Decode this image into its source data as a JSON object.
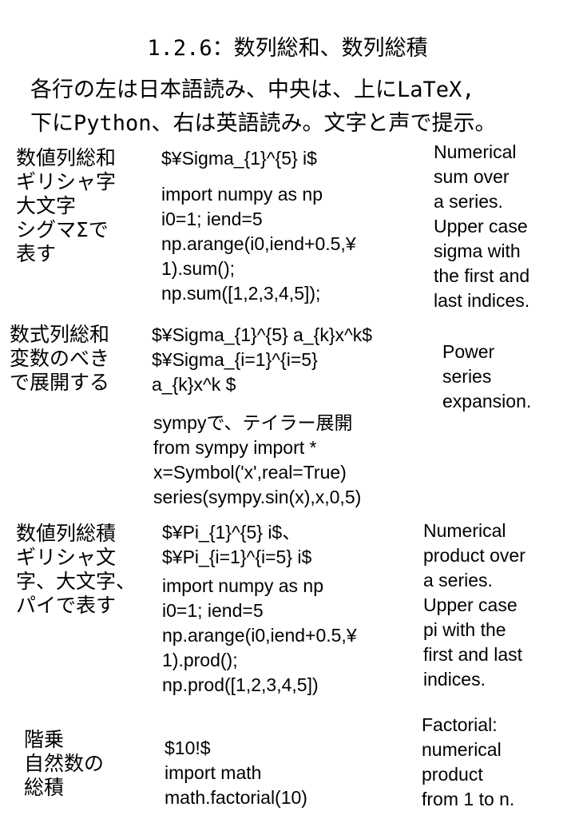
{
  "title": "1.2.6：数列総和、数列総積",
  "intro": [
    "各行の左は日本語読み、中央は、上にLaTeX,",
    "下にPython、右は英語読み。文字と声で提示。"
  ],
  "rows": [
    {
      "jp": [
        "数値列総和",
        "ギリシャ字",
        "大文字",
        "シグマΣで",
        "表す"
      ],
      "latex": [
        "$¥Sigma_{1}^{5} i$"
      ],
      "code": [
        "import numpy as np",
        "i0=1; iend=5",
        "np.arange(i0,iend+0.5,¥",
        "1).sum();",
        "np.sum([1,2,3,4,5]);"
      ],
      "en": [
        "Numerical",
        "sum over",
        "a series.",
        "Upper case",
        "sigma with",
        "the first and",
        "last indices."
      ]
    },
    {
      "jp": [
        "数式列総和",
        "変数のべき",
        "で展開する"
      ],
      "latex": [
        "$¥Sigma_{1}^{5} a_{k}x^k$",
        "$¥Sigma_{i=1}^{i=5}",
        "a_{k}x^k $"
      ],
      "code": [
        "sympyで、テイラー展開",
        "from sympy import *",
        "x=Symbol('x',real=True)",
        "series(sympy.sin(x),x,0,5)"
      ],
      "en": [
        "Power",
        "series",
        "expansion."
      ]
    },
    {
      "jp": [
        "数値列総積",
        "ギリシャ文",
        "字、大文字、",
        "パイで表す"
      ],
      "latex": [
        "$¥Pi_{1}^{5} i$、",
        "$¥Pi_{i=1}^{i=5} i$"
      ],
      "code": [
        "import numpy as np",
        "i0=1; iend=5",
        "np.arange(i0,iend+0.5,¥",
        "1).prod();",
        "np.prod([1,2,3,4,5])"
      ],
      "en": [
        "Numerical",
        "product over",
        "a series.",
        "Upper case",
        "pi with the",
        "first and last",
        "indices."
      ]
    },
    {
      "jp": [
        "階乗",
        "自然数の",
        "総積"
      ],
      "latex": [
        "$10!$"
      ],
      "code": [
        "import math",
        "math.factorial(10)"
      ],
      "en": [
        "Factorial:",
        "numerical",
        "product",
        "from 1 to n."
      ]
    }
  ]
}
